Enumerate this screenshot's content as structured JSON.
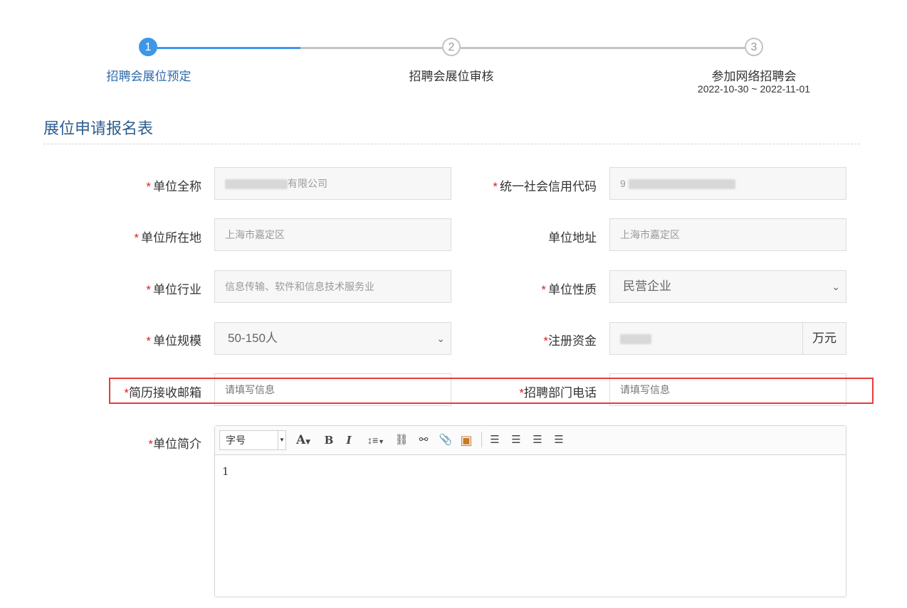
{
  "stepper": {
    "steps": [
      {
        "number": "1",
        "label": "招聘会展位预定",
        "date": ""
      },
      {
        "number": "2",
        "label": "招聘会展位审核",
        "date": ""
      },
      {
        "number": "3",
        "label": "参加网络招聘会",
        "date": "2022-10-30 ~ 2022-11-01"
      }
    ],
    "active_step": 1,
    "progress_fraction": 0.25,
    "colors": {
      "active": "#3d97e8",
      "inactive": "#c4c4c4",
      "active_label": "#2e6aa9"
    }
  },
  "section": {
    "title": "展位申请报名表"
  },
  "form": {
    "required_mark": "*",
    "company_name": {
      "label": "单位全称",
      "value_visible": "有限公司"
    },
    "credit_code": {
      "label": "统一社会信用代码",
      "value_visible": "9"
    },
    "location": {
      "label": "单位所在地",
      "value": "上海市嘉定区"
    },
    "address": {
      "label": "单位地址",
      "value": "上海市嘉定区"
    },
    "industry": {
      "label": "单位行业",
      "value": "信息传输、软件和信息技术服务业"
    },
    "nature": {
      "label": "单位性质",
      "selected": "民营企业"
    },
    "scale": {
      "label": "单位规模",
      "selected": "50-150人"
    },
    "capital": {
      "label": "注册资金",
      "unit": "万元"
    },
    "email": {
      "label": "简历接收邮箱",
      "placeholder": "请填写信息"
    },
    "phone": {
      "label": "招聘部门电话",
      "placeholder": "请填写信息"
    },
    "intro": {
      "label": "单位简介",
      "content": "1"
    }
  },
  "editor_toolbar": {
    "font_size_label": "字号",
    "icons": [
      "font-color-icon",
      "bold-icon",
      "italic-icon",
      "line-height-icon",
      "link-icon",
      "unlink-icon",
      "attachment-icon",
      "image-icon",
      "align-left-icon",
      "align-center-icon",
      "align-right-icon",
      "align-justify-icon"
    ],
    "glyphs": {
      "font_color": "A",
      "bold": "B",
      "italic": "I",
      "line_height": "↕≡",
      "link": "⛓",
      "unlink": "⚯",
      "attachment": "📎",
      "image": "▣",
      "align_left": "☰",
      "align_center": "☰",
      "align_right": "☰",
      "justify": "☰"
    }
  },
  "highlight_color": "#e53c3c"
}
